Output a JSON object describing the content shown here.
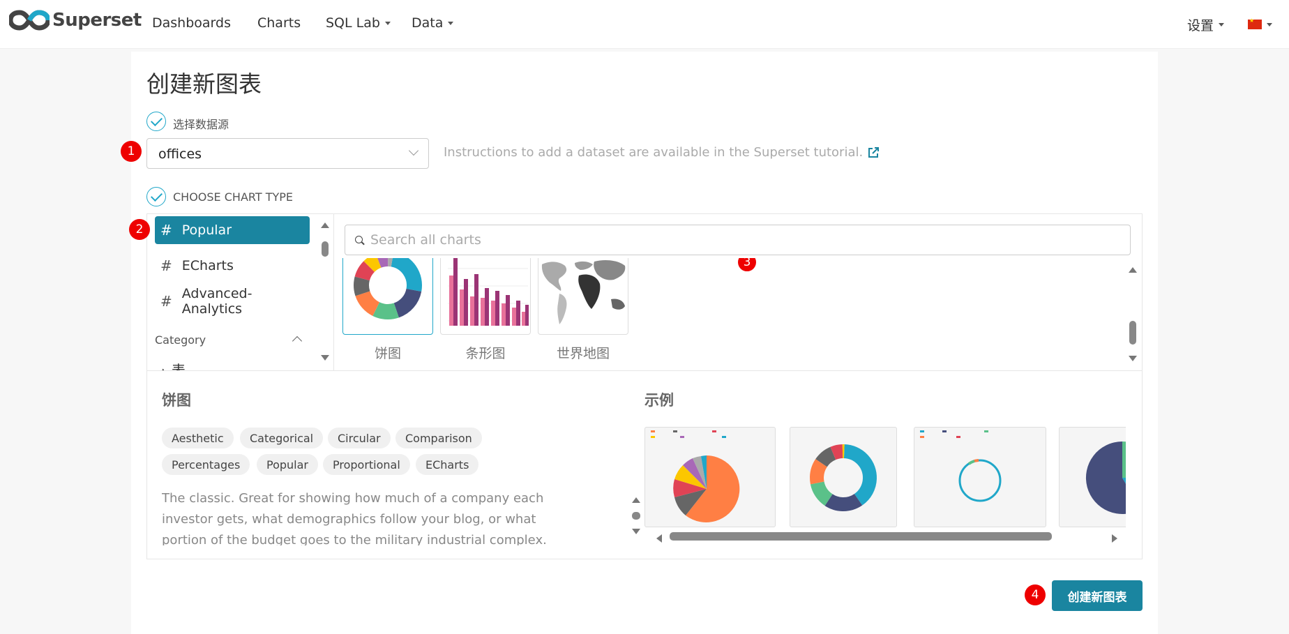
{
  "navbar": {
    "brand": "Superset",
    "items": [
      {
        "label": "Dashboards"
      },
      {
        "label": "Charts"
      },
      {
        "label": "SQL Lab"
      },
      {
        "label": "Data"
      }
    ],
    "settings": "设置",
    "language_flag": "flag-cn-icon"
  },
  "page": {
    "title": "创建新图表",
    "step1_label": "选择数据源",
    "step2_label": "CHOOSE CHART TYPE",
    "dataset_value": "offices",
    "instructions": "Instructions to add a dataset are available in the Superset tutorial."
  },
  "badges": [
    "1",
    "2",
    "3",
    "4"
  ],
  "sidebar": {
    "items": [
      {
        "label": "Popular",
        "active": true
      },
      {
        "label": "ECharts",
        "active": false
      },
      {
        "label": "Advanced-Analytics",
        "active": false
      }
    ],
    "category_label": "Category",
    "cut_item": "表"
  },
  "search": {
    "placeholder": "Search all charts"
  },
  "thumbnails": [
    {
      "label": "饼图",
      "selected": true
    },
    {
      "label": "条形图",
      "selected": false
    },
    {
      "label": "世界地图",
      "selected": false
    }
  ],
  "detail": {
    "title": "饼图",
    "tags": [
      "Aesthetic",
      "Categorical",
      "Circular",
      "Comparison",
      "Percentages",
      "Popular",
      "Proportional",
      "ECharts"
    ],
    "description": "The classic. Great for showing how much of a company each investor gets, what demographics follow your blog, or what portion of the budget goes to the military industrial complex. Pie",
    "examples_title": "示例"
  },
  "create_button": "创建新图表",
  "colors": {
    "primary": "#1a85a0",
    "accent": "#20a7c9",
    "badge": "#ee0000"
  }
}
